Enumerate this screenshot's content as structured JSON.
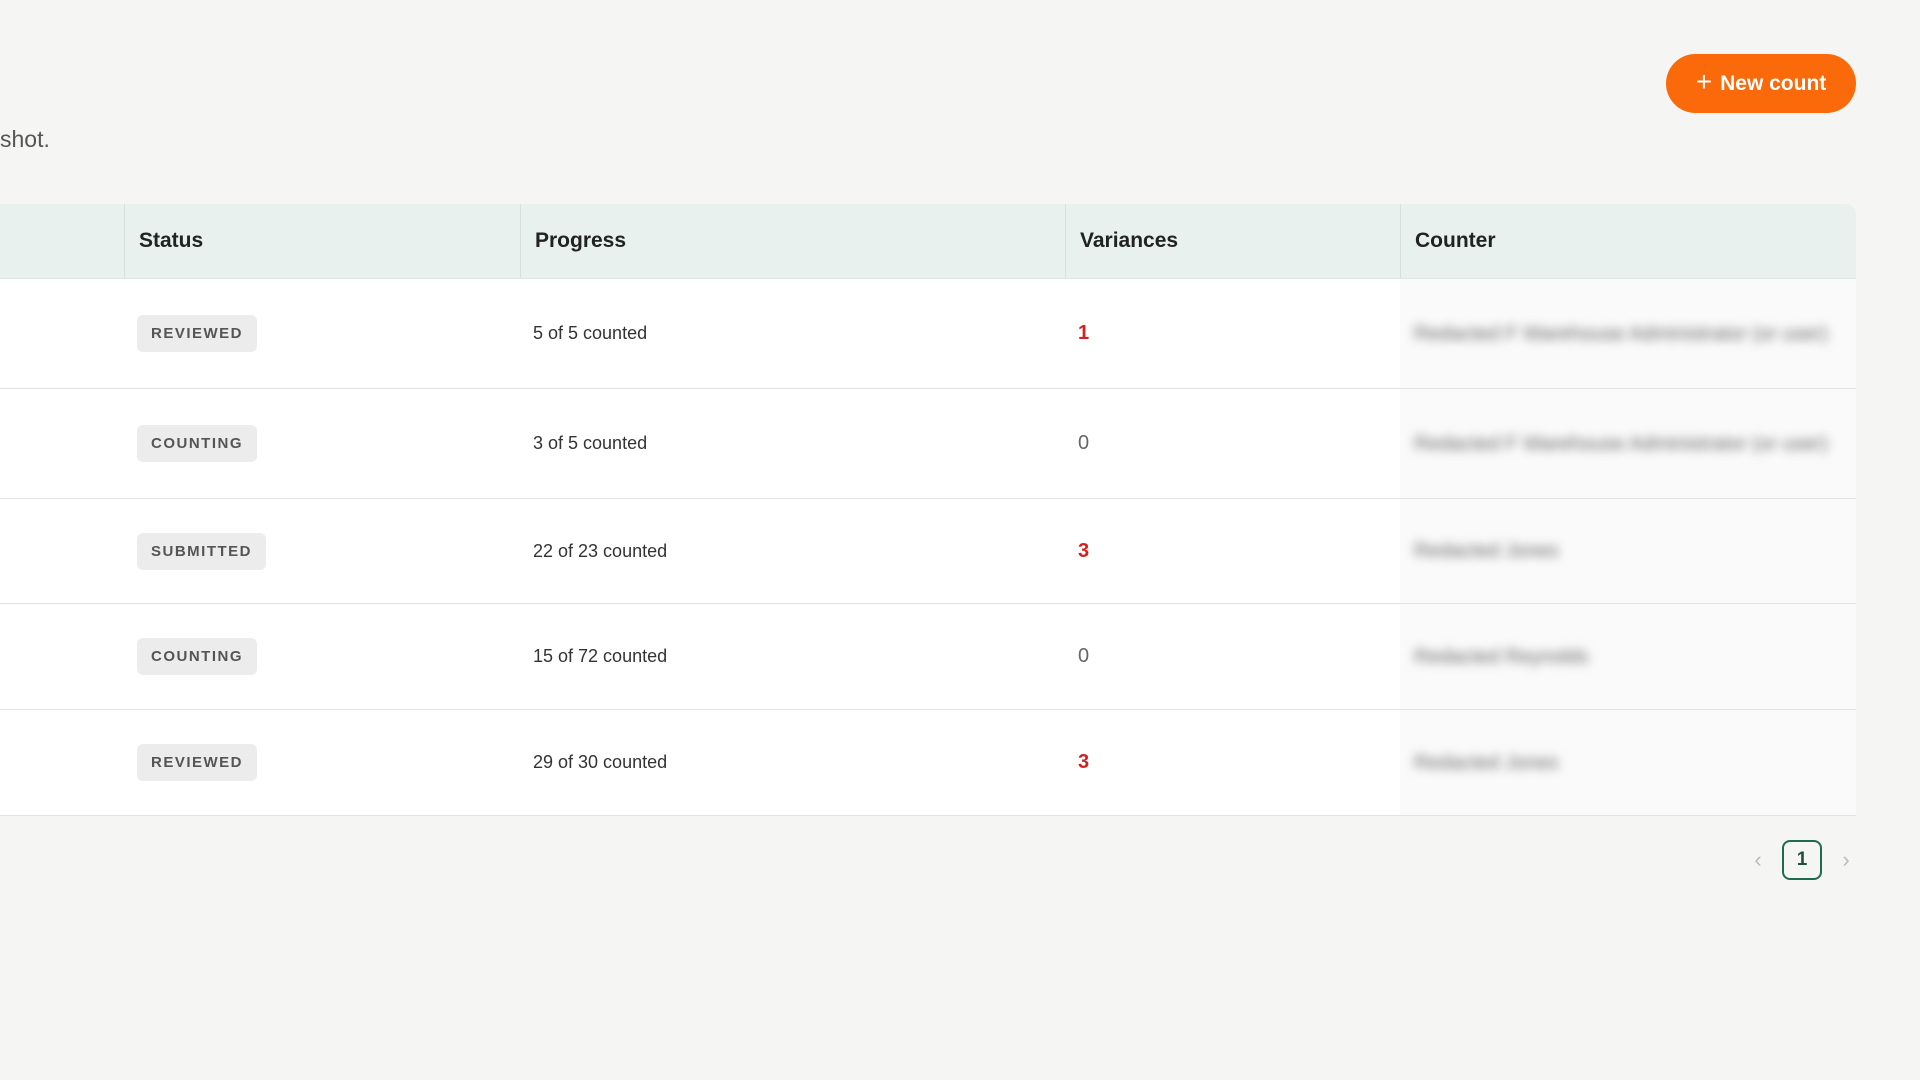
{
  "header": {
    "subtitle_fragment": "shot.",
    "new_button_label": "New count",
    "new_button_icon": "plus-icon"
  },
  "table": {
    "columns": [
      "Status",
      "Progress",
      "Variances",
      "Counter"
    ],
    "rows": [
      {
        "status": "REVIEWED",
        "progress": "5 of 5 counted",
        "variances": "1",
        "variance_alert": true,
        "counter": "Redacted F Warehouse Administrator (or user)"
      },
      {
        "status": "COUNTING",
        "progress": "3 of 5 counted",
        "variances": "0",
        "variance_alert": false,
        "counter": "Redacted F Warehouse Administrator (or user)"
      },
      {
        "status": "SUBMITTED",
        "progress": "22 of 23 counted",
        "variances": "3",
        "variance_alert": true,
        "counter": "Redacted Jones"
      },
      {
        "status": "COUNTING",
        "progress": "15 of 72 counted",
        "variances": "0",
        "variance_alert": false,
        "counter": "Redacted Reynolds"
      },
      {
        "status": "REVIEWED",
        "progress": "29 of 30 counted",
        "variances": "3",
        "variance_alert": true,
        "counter": "Redacted Jones"
      }
    ]
  },
  "pagination": {
    "current_page": "1",
    "prev_icon": "chevron-left-icon",
    "next_icon": "chevron-right-icon"
  },
  "colors": {
    "accent": "#fa6a0a",
    "header_bg": "#e8f1ee",
    "alert": "#d32020",
    "pager_border": "#1f6b52"
  }
}
